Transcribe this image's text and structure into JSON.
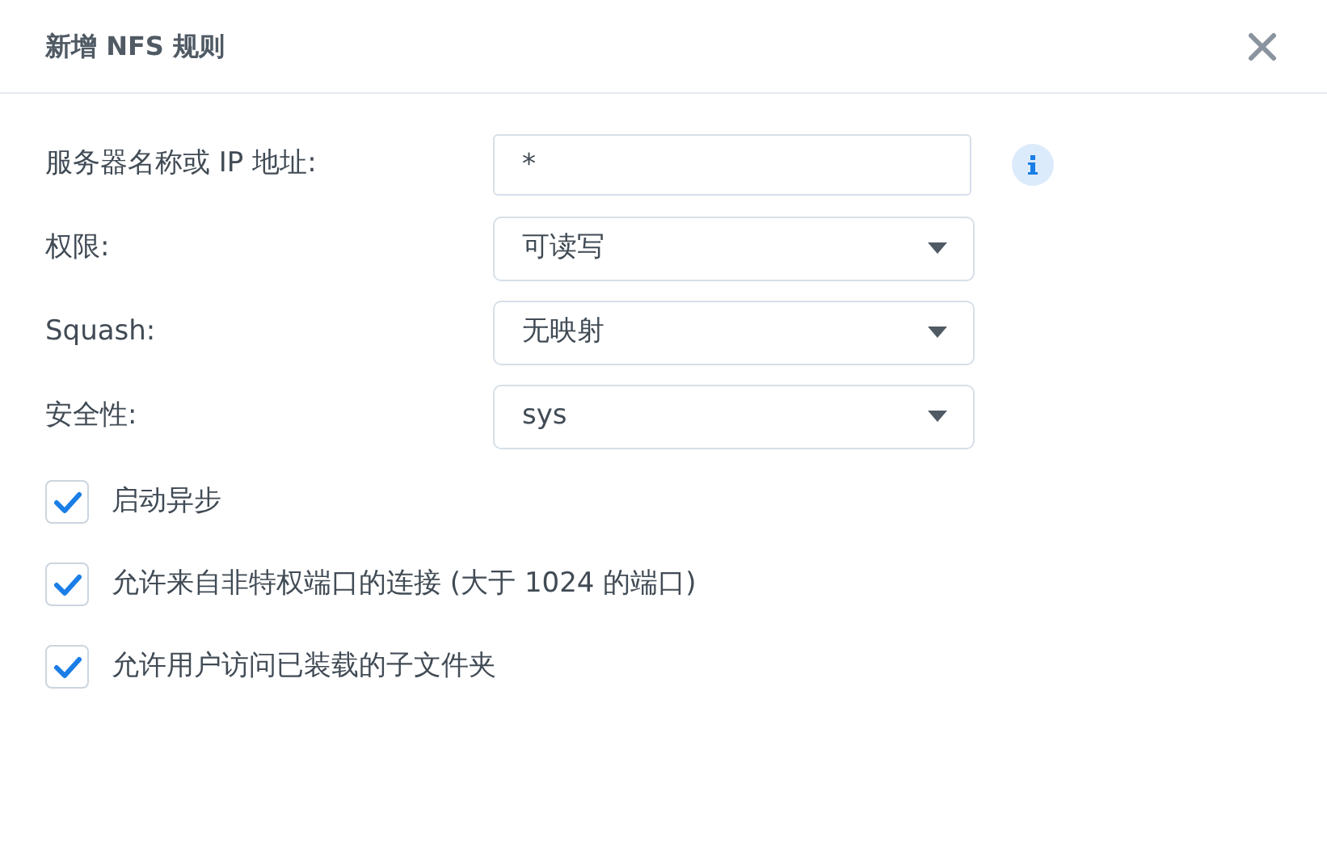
{
  "window": {
    "title": "新增 NFS 规则"
  },
  "fields": [
    {
      "label": "服务器名称或 IP 地址:",
      "kind": "text",
      "value": "*",
      "info": true
    },
    {
      "label": "权限:",
      "kind": "select",
      "value": "可读写"
    },
    {
      "label": "Squash:",
      "kind": "select",
      "value": "无映射"
    },
    {
      "label": "安全性:",
      "kind": "select",
      "value": "sys"
    }
  ],
  "options": [
    {
      "label": "启动异步",
      "checked": true
    },
    {
      "label": "允许来自非特权端口的连接 (大于 1024 的端口)",
      "checked": true
    },
    {
      "label": "允许用户访问已装载的子文件夹",
      "checked": true
    }
  ]
}
